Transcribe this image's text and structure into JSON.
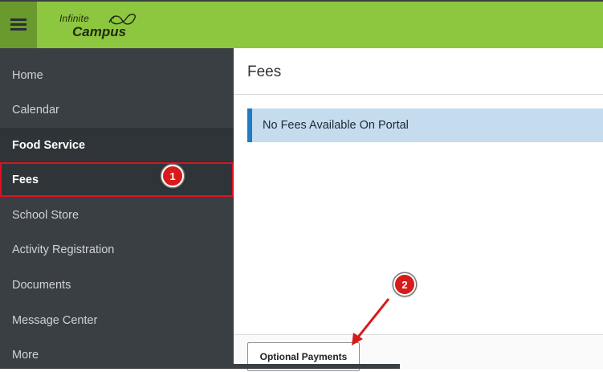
{
  "app": {
    "logo_top": "Infinite",
    "logo_bottom": "Campus",
    "brand_color": "#8dc63f",
    "sidebar_color": "#3a3f44"
  },
  "sidebar": {
    "items": [
      {
        "label": "Home"
      },
      {
        "label": "Calendar"
      },
      {
        "label": "Food Service"
      },
      {
        "label": "Fees"
      },
      {
        "label": "School Store"
      },
      {
        "label": "Activity Registration"
      },
      {
        "label": "Documents"
      },
      {
        "label": "Message Center"
      },
      {
        "label": "More"
      }
    ]
  },
  "main": {
    "title": "Fees",
    "alert": "No Fees Available On Portal",
    "optional_payments_label": "Optional Payments"
  },
  "annotations": {
    "callout_1": "1",
    "callout_2": "2",
    "highlight_color": "#e01020"
  }
}
